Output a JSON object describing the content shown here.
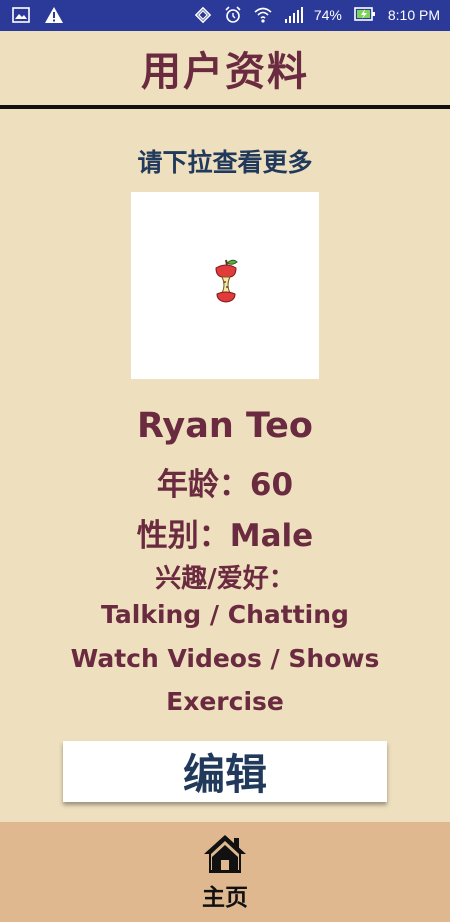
{
  "status_bar": {
    "battery": "74%",
    "time": "8:10 PM",
    "icons": [
      "gallery-icon",
      "warning-icon",
      "sync-icon",
      "alarm-icon",
      "wifi-icon",
      "signal-icon",
      "battery-charging-icon"
    ]
  },
  "header": {
    "title": "用户资料"
  },
  "profile": {
    "hint": "请下拉查看更多",
    "name": "Ryan Teo",
    "age": "年龄：60",
    "gender": "性别：Male",
    "hobbies_label": "兴趣/爱好：",
    "hobbies": [
      "Talking / Chatting",
      "Watch Videos / Shows",
      "Exercise"
    ],
    "photo_icon": "apple-core-icon"
  },
  "actions": {
    "edit_label": "编辑"
  },
  "bottom_nav": {
    "home_label": "主页",
    "home_icon": "home-icon"
  },
  "colors": {
    "background": "#eedfbe",
    "status_bar": "#2b3a99",
    "title": "#6a2a3f",
    "accent_blue": "#213a5c",
    "nav_bar": "#dfb88f"
  }
}
